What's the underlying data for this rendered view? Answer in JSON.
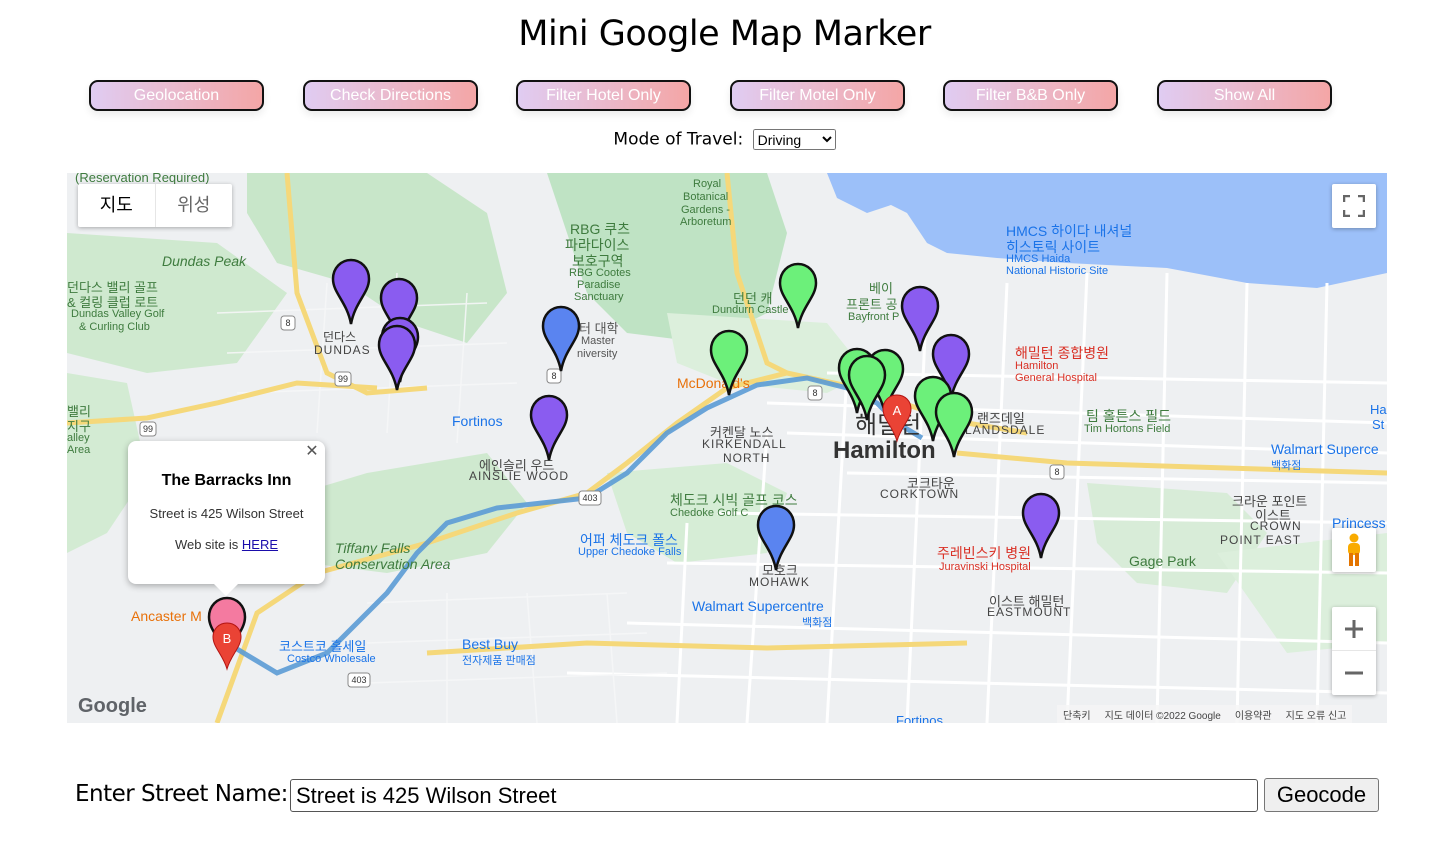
{
  "title": "Mini Google Map Marker",
  "buttons": {
    "geolocation": "Geolocation",
    "check_directions": "Check Directions",
    "filter_hotel": "Filter Hotel Only",
    "filter_motel": "Filter Motel Only",
    "filter_bnb": "Filter B&B Only",
    "show_all": "Show All"
  },
  "travel": {
    "label": "Mode of Travel:",
    "selected": "Driving"
  },
  "map": {
    "type_map": "지도",
    "type_satellite": "위성",
    "google_logo": "Google",
    "footer_shortcuts": "단축키",
    "footer_data": "지도 데이터 ©2022 Google",
    "footer_terms": "이용약관",
    "footer_report": "지도 오류 신고",
    "info_window": {
      "title": "The Barracks Inn",
      "street": "Street is 425 Wilson Street",
      "website_prefix": "Web site is ",
      "website_link": "HERE"
    },
    "labels": {
      "reservation": "(Reservation Required)",
      "royal_botanical": "Royal",
      "royal_botanical2": "Botanical",
      "royal_botanical3": "Gardens -",
      "royal_botanical4": "Arboretum",
      "rbg_kr1": "RBG 쿠츠",
      "rbg_kr2": "파라다이스",
      "rbg_kr3": "보호구역",
      "rbg_en1": "RBG Cootes",
      "rbg_en2": "Paradise",
      "rbg_en3": "Sanctuary",
      "dundas_peak": "Dundas Peak",
      "dundas_valley_kr1": "던다스 밸리 골프",
      "dundas_valley_kr2": "& 컬링 클럽 로트",
      "dundas_valley_en1": "Dundas Valley Golf",
      "dundas_valley_en2": "& Curling Club",
      "dundas_kr": "던다스",
      "dundas_en": "DUNDAS",
      "mcmaster_kr": "터 대학",
      "mcmaster_en1": "Master",
      "mcmaster_en2": "niversity",
      "dundurn_kr": "던던 캐",
      "dundurn_en": "Dundurn Castle",
      "bayfront_kr1": "베이",
      "bayfront_kr2": "프론트 공",
      "bayfront_en": "Bayfront P",
      "hmcs_kr1": "HMCS 하이다 내셔널",
      "hmcs_kr2": "히스토릭 사이트",
      "hmcs_en1": "HMCS Haida",
      "hmcs_en2": "National Historic Site",
      "hgh_kr": "해밀턴 종합병원",
      "hgh_en1": "Hamilton",
      "hgh_en2": "General Hospital",
      "mcdonalds": "McDonald's",
      "fortinos": "Fortinos",
      "kirkendall_kr": "커켄달 노스",
      "kirkendall_en1": "KIRKENDALL",
      "kirkendall_en2": "NORTH",
      "ainslie_kr": "에인슬리 우드",
      "ainslie_en": "AINSLIE WOOD",
      "hamilton_kr": "해밀턴",
      "hamilton_en": "Hamilton",
      "landsdale_kr": "랜즈데일",
      "landsdale_en": "LANDSDALE",
      "tim_kr": "팀 홀튼스 필드",
      "tim_en": "Tim Hortons Field",
      "walmart_kr": "Walmart Superce",
      "walmart_kr2": "백화점",
      "corktown_kr": "코크타운",
      "corktown_en": "CORKTOWN",
      "chedoke_kr": "체도크 시빅 골프 코스",
      "chedoke_en": "Chedoke Golf C",
      "upper_chedoke_kr": "어퍼 체도크 폴스",
      "upper_chedoke_en": "Upper Chedoke Falls",
      "tiffany_kr": "Tiffany Falls",
      "tiffany_en": "Conservation Area",
      "mohawk_kr": "모호크",
      "mohawk_en": "MOHAWK",
      "juravinski_kr": "주레빈스키 병원",
      "juravinski_en": "Juravinski Hospital",
      "crown_kr1": "크라운 포인트",
      "crown_kr2": "이스트",
      "crown_en1": "CROWN",
      "crown_en2": "POINT EAST",
      "gage_park": "Gage Park",
      "princess": "Princess",
      "eastmount_kr": "이스트 해밀턴",
      "eastmount_en": "EASTMOUNT",
      "walmart2_en": "Walmart Supercentre",
      "walmart2_kr": "백화점",
      "costco_kr": "코스트코 홀세일",
      "costco_en": "Costco Wholesale",
      "bestbuy_en": "Best Buy",
      "bestbuy_kr": "전자제품 판매점",
      "ancaster": "Ancaster M",
      "hamilton_left_kr": "밸리",
      "hamilton_left_kr2": "지구",
      "hamilton_left_en1": "alley",
      "hamilton_left_en2": "Area",
      "fortinos2": "Fortinos",
      "ha_st": "Ha",
      "ha_st2": "St"
    },
    "route_markers": {
      "start": "A",
      "end": "B"
    },
    "road_shields": [
      "8",
      "99",
      "99",
      "8",
      "8",
      "403",
      "403",
      "8"
    ]
  },
  "geocode": {
    "label": "Enter Street Name:",
    "value": "Street is 425 Wilson Street",
    "button": "Geocode"
  },
  "colors": {
    "button_gradient_start": "#e0ccf2",
    "button_gradient_end": "#f4a6a6",
    "marker_purple": "#8a5cf0",
    "marker_green": "#6cf07a",
    "marker_blue": "#5a84f0",
    "marker_pink": "#f47aa0",
    "route_blue": "#5b9bd5",
    "water": "#9cc0f9"
  }
}
